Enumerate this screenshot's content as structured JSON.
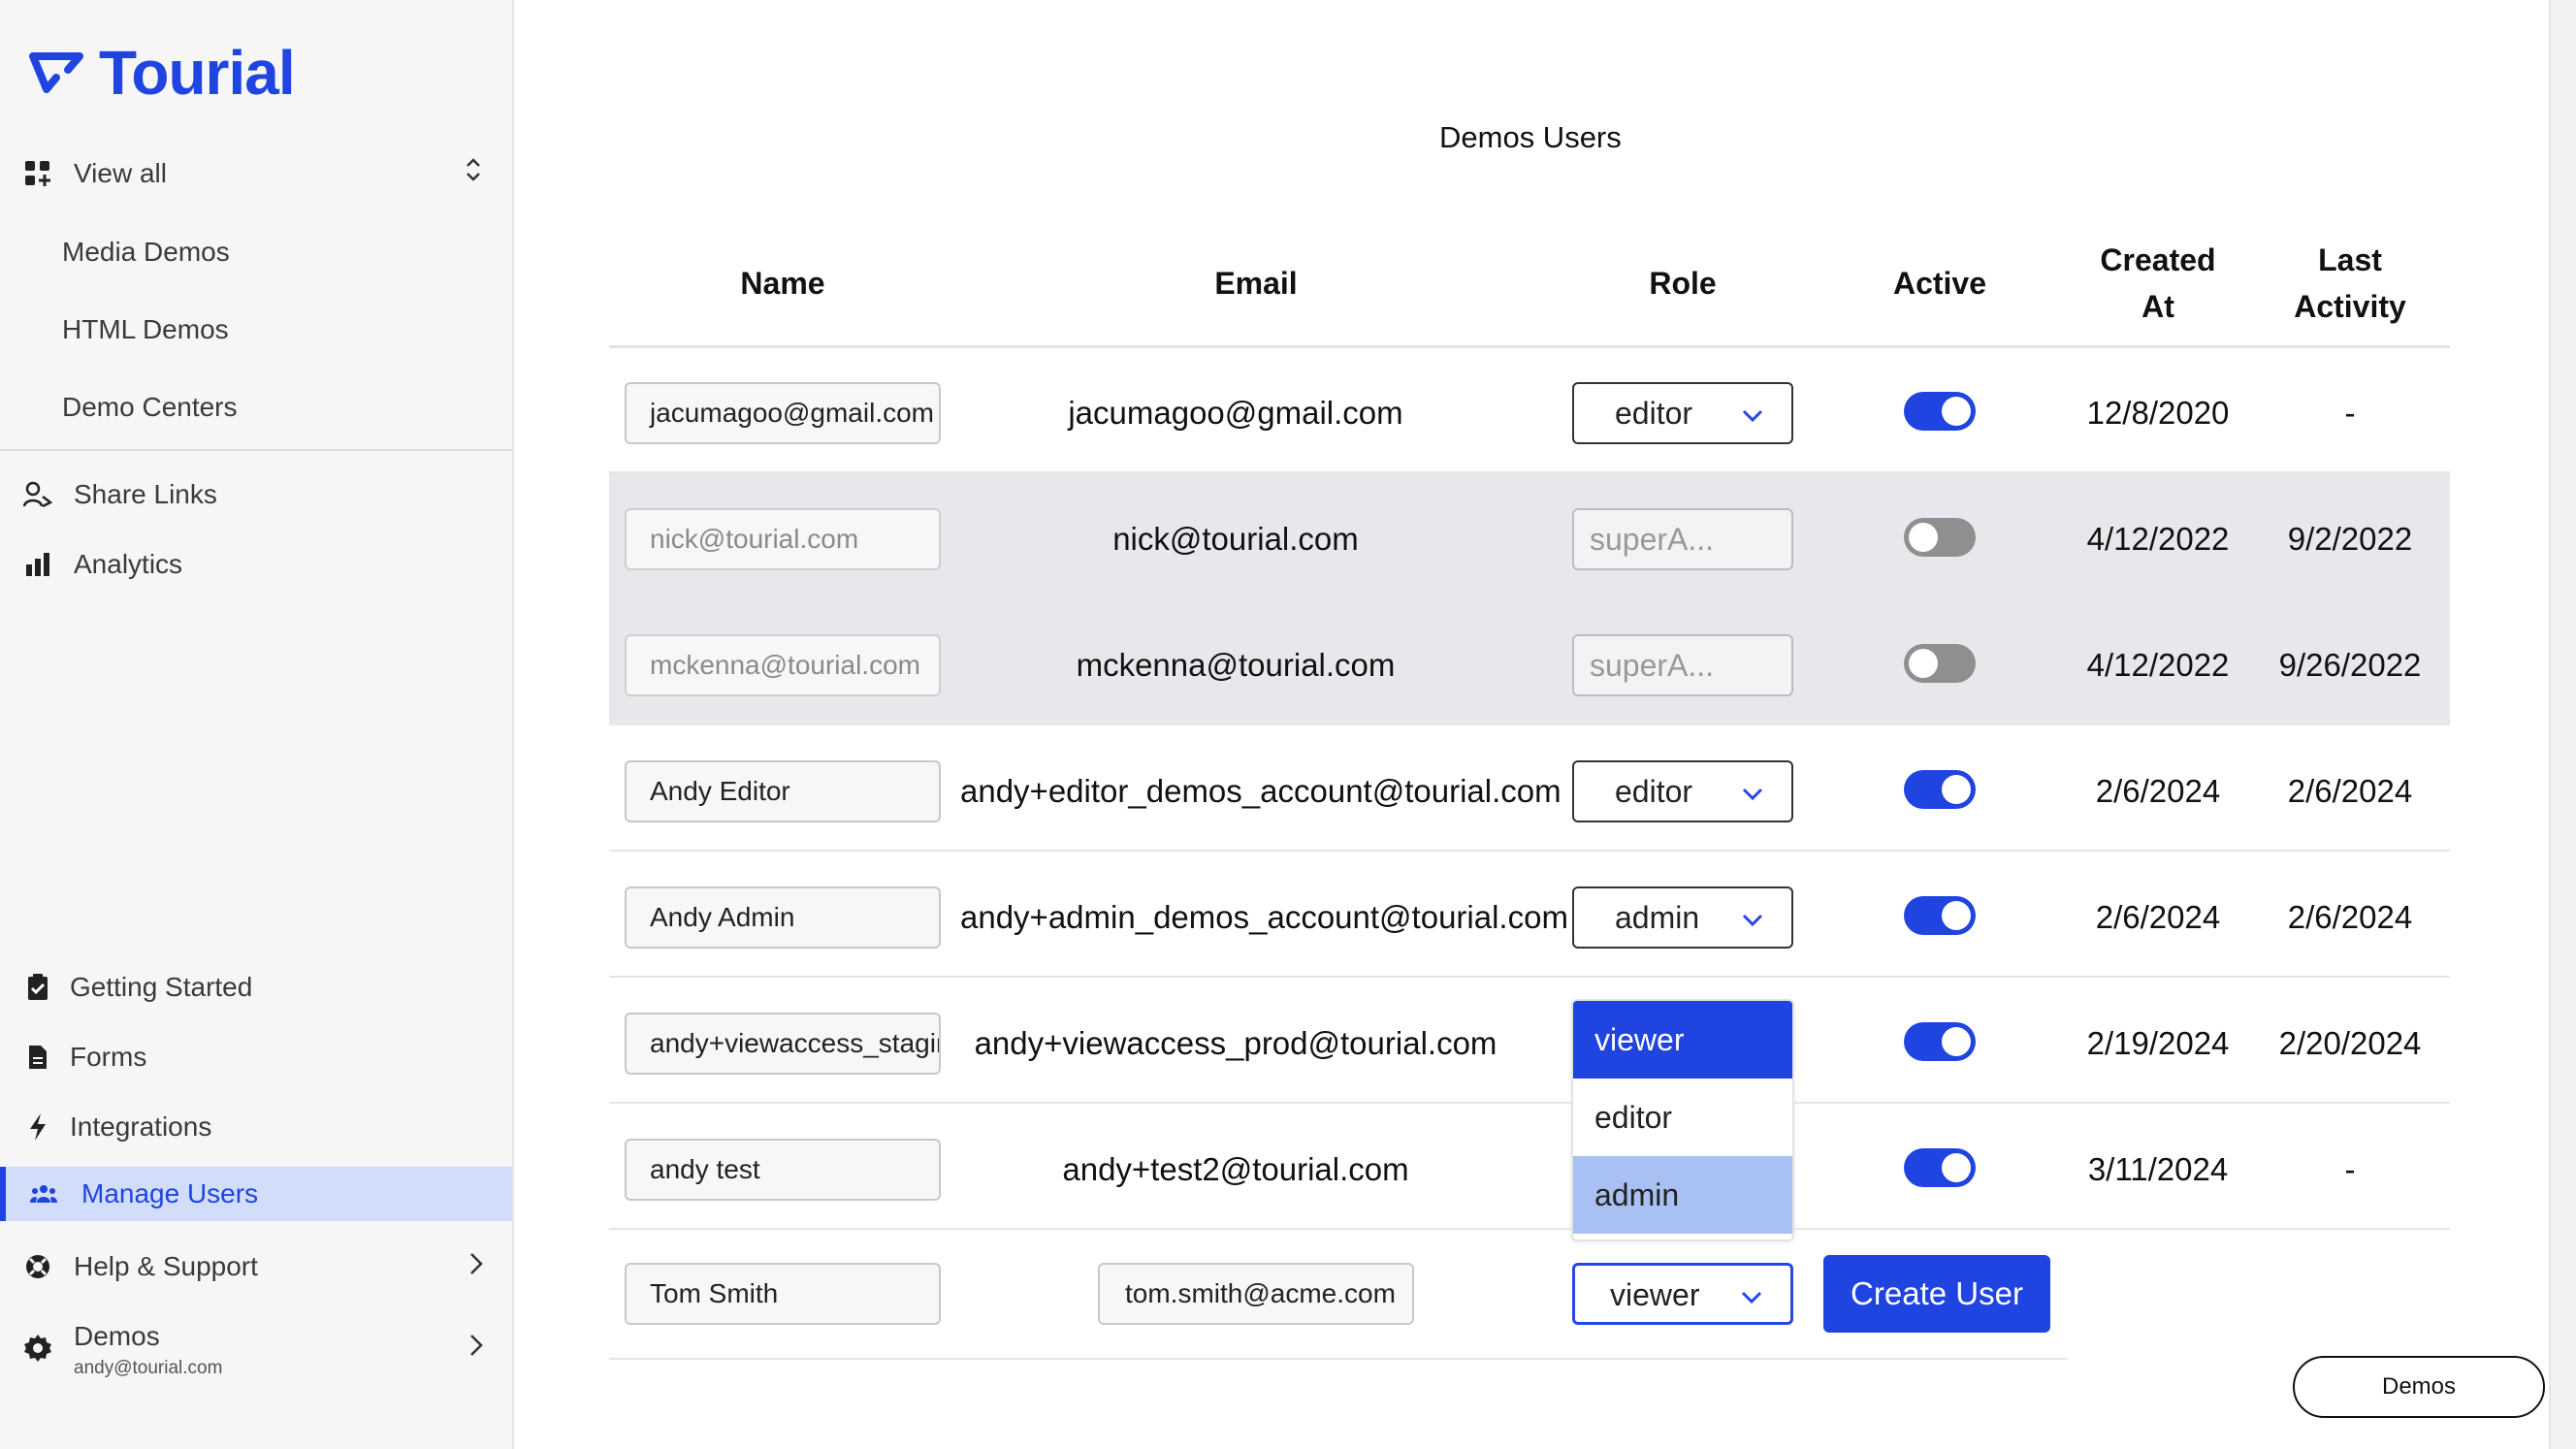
{
  "brand": {
    "name": "Tourial",
    "color": "#1f44e0"
  },
  "sidebar": {
    "view_all": "View all",
    "sub_items": [
      "Media Demos",
      "HTML Demos",
      "Demo Centers"
    ],
    "items": [
      "Share Links",
      "Analytics"
    ],
    "bottom_items": [
      "Getting Started",
      "Forms",
      "Integrations",
      "Manage Users",
      "Help & Support"
    ],
    "active": "Manage Users",
    "workspace": {
      "name": "Demos",
      "email": "andy@tourial.com"
    }
  },
  "page": {
    "title": "Demos Users",
    "columns": {
      "name": "Name",
      "email": "Email",
      "role": "Role",
      "active": "Active",
      "created_l1": "Created",
      "created_l2": "At",
      "last_l1": "Last",
      "last_l2": "Activity"
    }
  },
  "users": [
    {
      "name": "jacumagoo@gmail.com",
      "email": "jacumagoo@gmail.com",
      "role": "editor",
      "active": true,
      "created": "12/8/2020",
      "last": "-"
    },
    {
      "name": "nick@tourial.com",
      "email": "nick@tourial.com",
      "role": "superA...",
      "active": false,
      "created": "4/12/2022",
      "last": "9/2/2022"
    },
    {
      "name": "mckenna@tourial.com",
      "email": "mckenna@tourial.com",
      "role": "superA...",
      "active": false,
      "created": "4/12/2022",
      "last": "9/26/2022"
    },
    {
      "name": "Andy Editor",
      "email": "andy+editor_demos_account@tourial.com",
      "role": "editor",
      "active": true,
      "created": "2/6/2024",
      "last": "2/6/2024"
    },
    {
      "name": "Andy Admin",
      "email": "andy+admin_demos_account@tourial.com",
      "role": "admin",
      "active": true,
      "created": "2/6/2024",
      "last": "2/6/2024"
    },
    {
      "name": "andy+viewaccess_stagin",
      "email": "andy+viewaccess_prod@tourial.com",
      "role": "viewer",
      "active": true,
      "created": "2/19/2024",
      "last": "2/20/2024"
    },
    {
      "name": "andy test",
      "email": "andy+test2@tourial.com",
      "role": "viewer",
      "active": true,
      "created": "3/11/2024",
      "last": "-"
    }
  ],
  "new_user": {
    "name": "Tom Smith",
    "email": "tom.smith@acme.com",
    "role": "viewer",
    "button": "Create User"
  },
  "role_menu": {
    "options": [
      "viewer",
      "editor",
      "admin"
    ],
    "selected": "viewer",
    "hovered": "admin"
  },
  "floating": {
    "demos": "Demos"
  }
}
